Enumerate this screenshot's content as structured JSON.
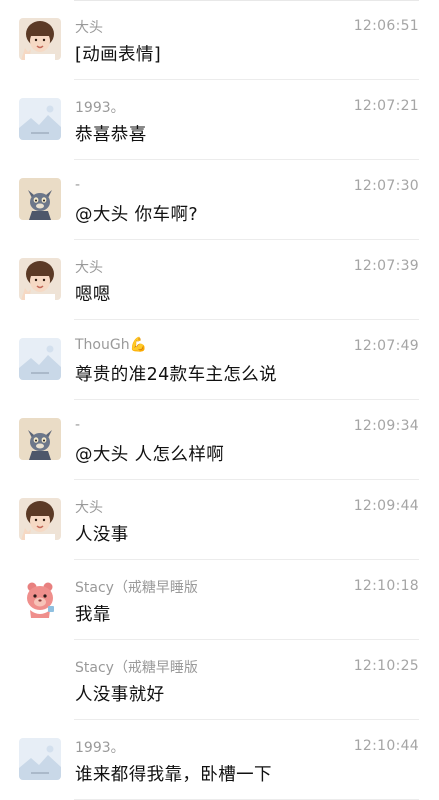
{
  "messages": [
    {
      "sender": "大头",
      "time": "12:06:51",
      "text": "[动画表情]",
      "avatar": "girl-photo-avatar"
    },
    {
      "sender": "1993。",
      "time": "12:07:21",
      "text": "恭喜恭喜",
      "avatar": "placeholder-landscape-avatar"
    },
    {
      "sender": "-",
      "time": "12:07:30",
      "text": "@大头 你车啊?",
      "avatar": "cat-avatar"
    },
    {
      "sender": "大头",
      "time": "12:07:39",
      "text": "嗯嗯",
      "avatar": "girl-photo-avatar"
    },
    {
      "sender": "ThouGh💪",
      "time": "12:07:49",
      "text": "尊贵的准24款车主怎么说",
      "avatar": "placeholder-landscape-avatar"
    },
    {
      "sender": "-",
      "time": "12:09:34",
      "text": "@大头 人怎么样啊",
      "avatar": "cat-avatar"
    },
    {
      "sender": "大头",
      "time": "12:09:44",
      "text": "人没事",
      "avatar": "girl-photo-avatar"
    },
    {
      "sender": "Stacy（戒糖早睡版",
      "time": "12:10:18",
      "text": "我靠",
      "avatar": "pink-bear-avatar"
    },
    {
      "sender": "Stacy（戒糖早睡版",
      "time": "12:10:25",
      "text": "人没事就好",
      "avatar": "none"
    },
    {
      "sender": "1993。",
      "time": "12:10:44",
      "text": "谁来都得我靠，卧槽一下",
      "avatar": "placeholder-landscape-avatar"
    }
  ]
}
